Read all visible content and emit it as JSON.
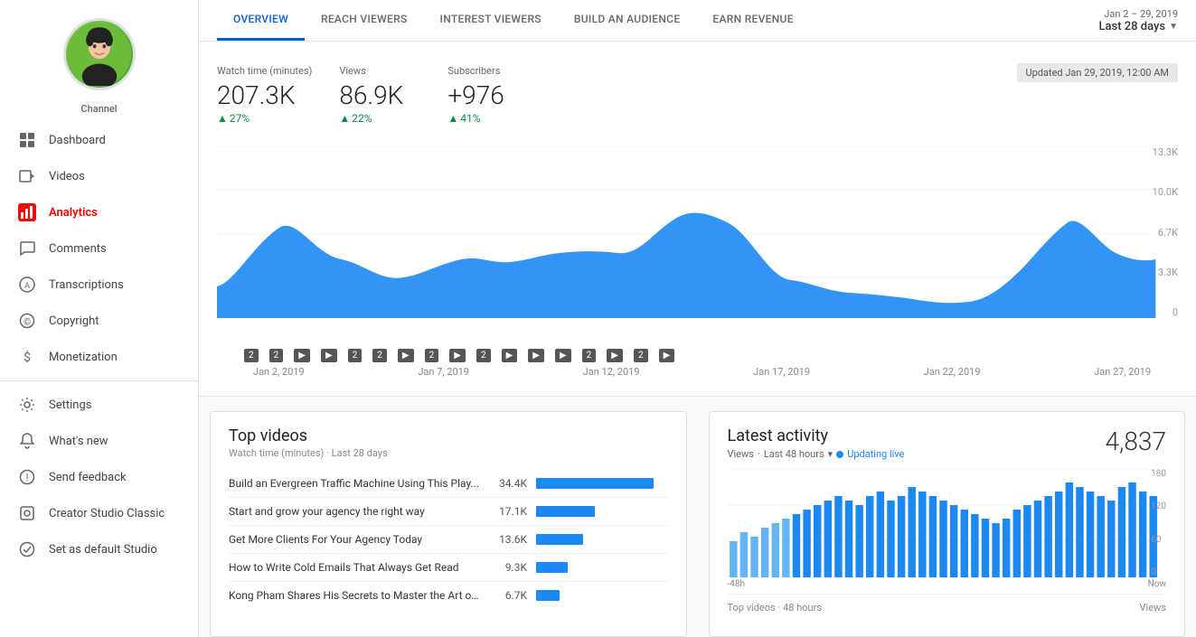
{
  "sidebar": {
    "channel_label": "Channel",
    "items": [
      {
        "id": "dashboard",
        "label": "Dashboard",
        "icon": "grid"
      },
      {
        "id": "videos",
        "label": "Videos",
        "icon": "video"
      },
      {
        "id": "analytics",
        "label": "Analytics",
        "icon": "analytics",
        "active": true
      },
      {
        "id": "comments",
        "label": "Comments",
        "icon": "comment"
      },
      {
        "id": "transcriptions",
        "label": "Transcriptions",
        "icon": "transcription"
      },
      {
        "id": "copyright",
        "label": "Copyright",
        "icon": "copyright"
      },
      {
        "id": "monetization",
        "label": "Monetization",
        "icon": "dollar"
      },
      {
        "id": "settings",
        "label": "Settings",
        "icon": "gear"
      },
      {
        "id": "whats-new",
        "label": "What's new",
        "icon": "bell"
      },
      {
        "id": "send-feedback",
        "label": "Send feedback",
        "icon": "feedback"
      },
      {
        "id": "creator-studio",
        "label": "Creator Studio Classic",
        "icon": "creator"
      },
      {
        "id": "set-default",
        "label": "Set as default Studio",
        "icon": "check"
      }
    ]
  },
  "topnav": {
    "tabs": [
      {
        "id": "overview",
        "label": "OVERVIEW",
        "active": true
      },
      {
        "id": "reach",
        "label": "REACH VIEWERS",
        "active": false
      },
      {
        "id": "interest",
        "label": "INTEREST VIEWERS",
        "active": false
      },
      {
        "id": "audience",
        "label": "BUILD AN AUDIENCE",
        "active": false
      },
      {
        "id": "revenue",
        "label": "EARN REVENUE",
        "active": false
      }
    ],
    "date_range_small": "Jan 2 – 29, 2019",
    "date_range_main": "Last 28 days"
  },
  "stats": {
    "watch_time": {
      "label": "Watch time (minutes)",
      "value": "207.3K",
      "change": "27%"
    },
    "views": {
      "label": "Views",
      "value": "86.9K",
      "change": "22%"
    },
    "subscribers": {
      "label": "Subscribers",
      "value": "+976",
      "change": "41%"
    },
    "updated": "Updated Jan 29, 2019, 12:00 AM"
  },
  "chart": {
    "y_labels": [
      "13.3K",
      "10.0K",
      "6.7K",
      "3.3K",
      "0"
    ],
    "x_labels": [
      "Jan 2, 2019",
      "Jan 7, 2019",
      "Jan 12, 2019",
      "Jan 17, 2019",
      "Jan 22, 2019",
      "Jan 27, 2019"
    ]
  },
  "top_videos": {
    "title": "Top videos",
    "subtitle": "Watch time (minutes) · Last 28 days",
    "items": [
      {
        "title": "Build an Evergreen Traffic Machine Using This Play...",
        "value": "34.4K",
        "bar_pct": 100
      },
      {
        "title": "Start and grow your agency the right way",
        "value": "17.1K",
        "bar_pct": 50
      },
      {
        "title": "Get More Clients For Your Agency Today",
        "value": "13.6K",
        "bar_pct": 40
      },
      {
        "title": "How to Write Cold Emails That Always Get Read",
        "value": "9.3K",
        "bar_pct": 27
      },
      {
        "title": "Kong Pham Shares His Secrets to Master the Art of ...",
        "value": "6.7K",
        "bar_pct": 20
      }
    ]
  },
  "latest_activity": {
    "title": "Latest activity",
    "count": "4,837",
    "views_label": "Views",
    "time_label": "Last 48 hours",
    "updating_label": "Updating live",
    "y_labels": [
      "180",
      "120",
      "60",
      "0"
    ],
    "x_labels": [
      "-48h",
      "Now"
    ],
    "footer_left": "Top videos · 48 hours",
    "footer_right": "Views"
  }
}
